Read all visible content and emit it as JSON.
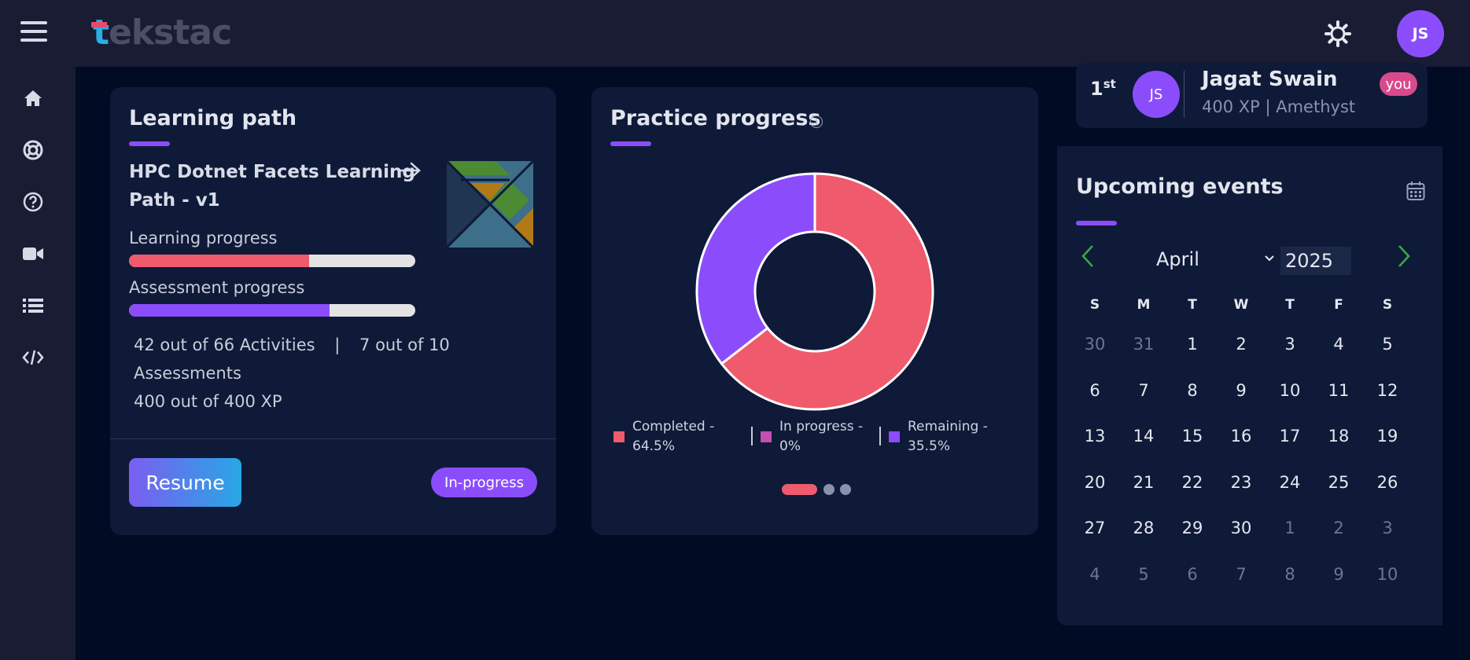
{
  "header": {
    "logo_text": "tekstac",
    "avatar_initials": "JS"
  },
  "sidebar": {
    "items": [
      {
        "icon": "home-icon"
      },
      {
        "icon": "lifebuoy-icon"
      },
      {
        "icon": "help-circle-icon"
      },
      {
        "icon": "video-icon"
      },
      {
        "icon": "list-icon"
      },
      {
        "icon": "code-icon"
      }
    ]
  },
  "learning_path": {
    "title": "Learning path",
    "name": "HPC Dotnet Facets Learning Path - v1",
    "learning_progress_label": "Learning progress",
    "learning_progress": 0.63,
    "assessment_progress_label": "Assessment progress",
    "assessment_progress": 0.7,
    "activities": "42 out of 66 Activities",
    "separator": "|",
    "assessments": "7 out of 10 Assessments",
    "xp": "400 out of 400 XP",
    "resume_label": "Resume",
    "status": "In-progress"
  },
  "practice": {
    "title": "Practice progress",
    "info_icon": "info-icon",
    "legend": [
      {
        "label": "Completed - 64.5%",
        "color": "#ef5a6c"
      },
      {
        "label": "In progress - 0%",
        "color": "#c54fb0"
      },
      {
        "label": "Remaining - 35.5%",
        "color": "#8b4dfc"
      }
    ]
  },
  "chart_data": {
    "type": "pie",
    "categories": [
      "Completed",
      "In progress",
      "Remaining"
    ],
    "values": [
      64.5,
      0,
      35.5
    ],
    "colors": [
      "#ef5a6c",
      "#c54fb0",
      "#8b4dfc"
    ],
    "title": "Practice progress",
    "legend_position": "bottom"
  },
  "leaderboard": {
    "rank": "1",
    "rank_suffix": "st",
    "initials": "JS",
    "name": "Jagat Swain",
    "xp": "400 XP | Amethyst",
    "badge": "you"
  },
  "events": {
    "title": "Upcoming events",
    "month": "April",
    "year": "2025",
    "weekdays": [
      "S",
      "M",
      "T",
      "W",
      "T",
      "F",
      "S"
    ],
    "weeks": [
      [
        "30",
        "31",
        "1",
        "2",
        "3",
        "4",
        "5"
      ],
      [
        "6",
        "7",
        "8",
        "9",
        "10",
        "11",
        "12"
      ],
      [
        "13",
        "14",
        "15",
        "16",
        "17",
        "18",
        "19"
      ],
      [
        "20",
        "21",
        "22",
        "23",
        "24",
        "25",
        "26"
      ],
      [
        "27",
        "28",
        "29",
        "30",
        "1",
        "2",
        "3"
      ],
      [
        "4",
        "5",
        "6",
        "7",
        "8",
        "9",
        "10"
      ]
    ],
    "muted_days": [
      [
        0,
        0
      ],
      [
        0,
        1
      ],
      [
        4,
        4
      ],
      [
        4,
        5
      ],
      [
        4,
        6
      ],
      [
        5,
        0
      ],
      [
        5,
        1
      ],
      [
        5,
        2
      ],
      [
        5,
        3
      ],
      [
        5,
        4
      ],
      [
        5,
        5
      ],
      [
        5,
        6
      ]
    ]
  },
  "colors": {
    "accent": "#8b4dfc",
    "completed": "#ef5a6c",
    "background": "#020b24",
    "card": "#0e1a38"
  }
}
